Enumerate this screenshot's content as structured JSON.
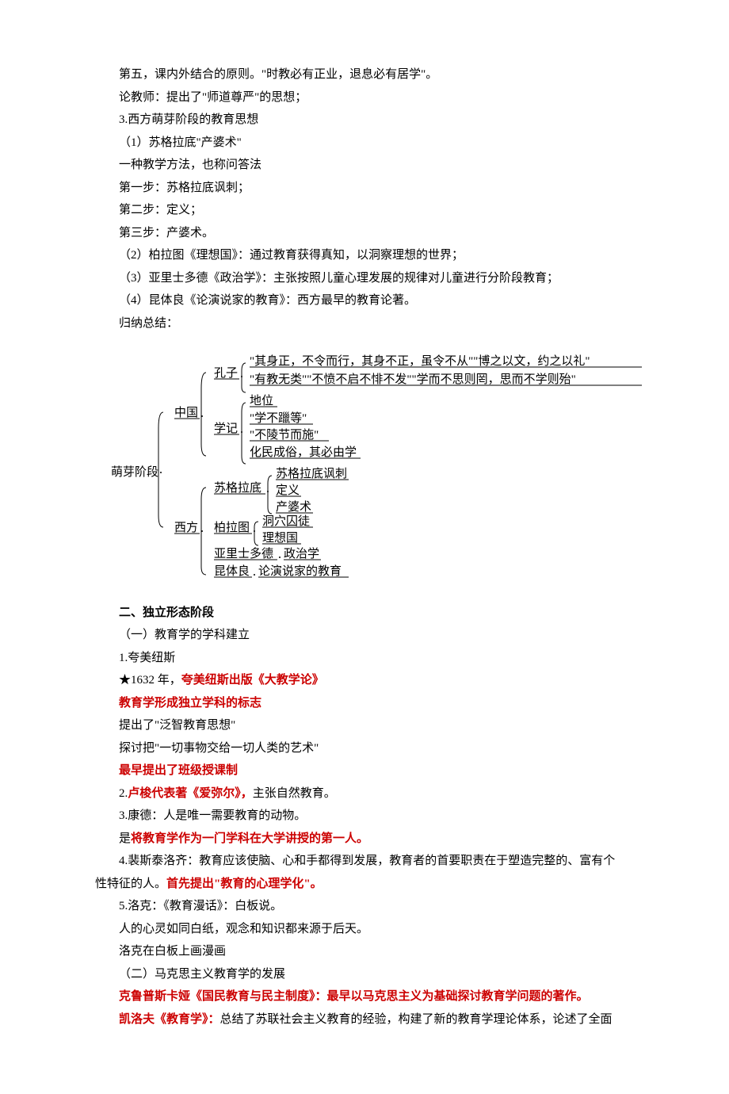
{
  "p": [
    {
      "cls": "line",
      "t": "第五，课内外结合的原则。\"时教必有正业，退息必有居学\"。"
    },
    {
      "cls": "line",
      "t": "论教师：提出了\"师道尊严\"的思想；"
    },
    {
      "cls": "line",
      "t": "3.西方萌芽阶段的教育思想"
    },
    {
      "cls": "line",
      "t": "（1）苏格拉底\"产婆术\""
    },
    {
      "cls": "line",
      "t": "一种教学方法，也称问答法"
    },
    {
      "cls": "line",
      "t": "第一步：苏格拉底讽刺；"
    },
    {
      "cls": "line",
      "t": "第二步：定义；"
    },
    {
      "cls": "line",
      "t": "第三步：产婆术。"
    },
    {
      "cls": "line",
      "t": "（2）柏拉图《理想国》：通过教育获得真知，以洞察理想的世界；"
    },
    {
      "cls": "line",
      "t": "（3）亚里士多德《政治学》：主张按照儿童心理发展的规律对儿童进行分阶段教育；"
    },
    {
      "cls": "line",
      "t": "（4）昆体良《论演说家的教育》：西方最早的教育论著。"
    },
    {
      "cls": "line",
      "t": "归纳总结："
    }
  ],
  "diagram": {
    "root": "萌芽阶段",
    "branches": [
      {
        "label": "中国",
        "children": [
          {
            "label": "孔子",
            "leaves": [
              "\"其身正，不令而行，其身不正，虽令不从\"\"博之以文，约之以礼\"",
              "\"有教无类\"\"不愤不启不悱不发\"\"学而不思则罔，思而不学则殆\""
            ]
          },
          {
            "label": "学记",
            "leaves": [
              "地位",
              "\"学不躐等\"",
              "\"不陵节而施\"",
              "化民成俗，其必由学"
            ]
          }
        ]
      },
      {
        "label": "西方",
        "children": [
          {
            "label": "苏格拉底",
            "leaves": [
              "苏格拉底讽刺",
              "定义",
              "产婆术"
            ]
          },
          {
            "label": "柏拉图",
            "leaves": [
              "洞穴囚徒",
              "理想国"
            ]
          },
          {
            "label": "亚里士多德",
            "leaves": [
              "政治学"
            ]
          },
          {
            "label": "昆体良",
            "leaves": [
              "论演说家的教育"
            ]
          }
        ]
      }
    ]
  },
  "p2": [
    {
      "cls": "line bold",
      "t": "二、独立形态阶段"
    },
    {
      "cls": "line",
      "t": "（一）教育学的学科建立"
    },
    {
      "cls": "line",
      "t": "1.夸美纽斯"
    },
    {
      "cls": "line",
      "html": "★1632 年，<span class='red'>夸美纽斯出版《大教学论》</span>"
    },
    {
      "cls": "line red",
      "t": "教育学形成独立学科的标志"
    },
    {
      "cls": "line",
      "t": "提出了\"泛智教育思想\""
    },
    {
      "cls": "line",
      "t": "探讨把\"一切事物交给一切人类的艺术\""
    },
    {
      "cls": "line red",
      "t": "最早提出了班级授课制"
    },
    {
      "cls": "line",
      "html": "2.<span class='red'>卢梭代表著《爱弥尔》，</span>主张自然教育。"
    },
    {
      "cls": "line",
      "t": "3.康德：人是唯一需要教育的动物。"
    },
    {
      "cls": "line",
      "html": "是<span class='red'>将教育学作为一门学科在大学讲授的第一人。</span>"
    },
    {
      "cls": "line",
      "t": "4.裴斯泰洛齐：教育应该使脑、心和手都得到发展，教育者的首要职责在于塑造完整的、富有个"
    }
  ],
  "p2tail": [
    {
      "cls": "line no-indent",
      "html": "性特征的人。<span class='red'>首先提出\"教育的心理学化\"。</span>"
    },
    {
      "cls": "line",
      "t": "5.洛克：《教育漫话》：白板说。"
    },
    {
      "cls": "line",
      "t": "人的心灵如同白纸，观念和知识都来源于后天。"
    },
    {
      "cls": "line",
      "t": "洛克在白板上画漫画"
    },
    {
      "cls": "line",
      "t": "（二）马克思主义教育学的发展"
    },
    {
      "cls": "line red",
      "t": "克鲁普斯卡娅《国民教育与民主制度》：最早以马克思主义为基础探讨教育学问题的著作。"
    },
    {
      "cls": "line",
      "html": "<span class='red'>凯洛夫《教育学》：</span>总结了苏联社会主义教育的经验，构建了新的教育学理论体系，论述了全面"
    }
  ]
}
